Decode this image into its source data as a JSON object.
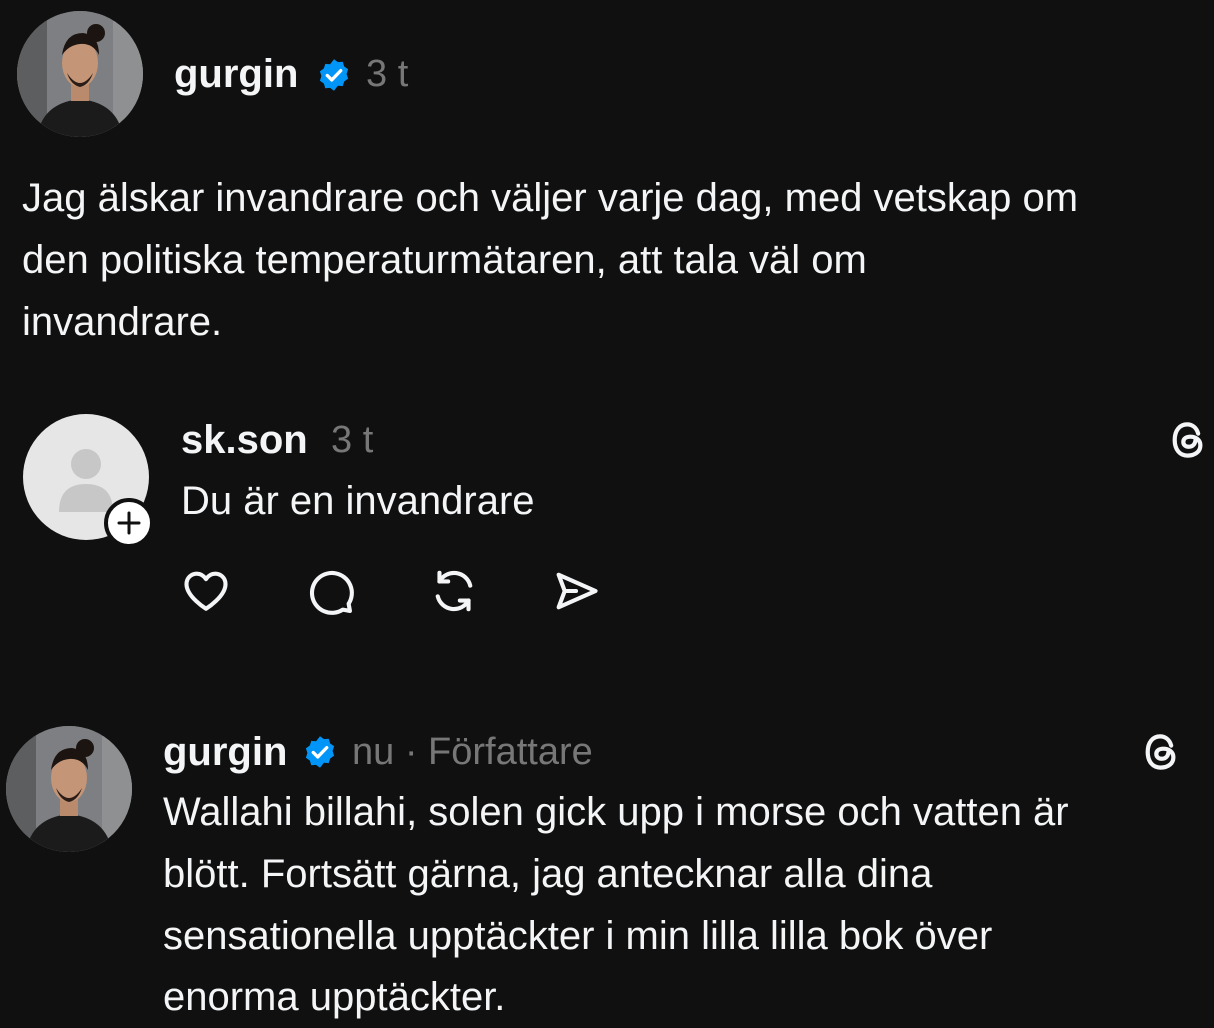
{
  "post": {
    "username": "gurgin",
    "time": "3 t",
    "text_lines": [
      "Jag älskar invandrare och väljer varje dag, med vetskap om",
      "den politiska temperaturmätaren, att tala väl om",
      "invandrare."
    ]
  },
  "reply": {
    "username": "sk.son",
    "time": "3 t",
    "text": "Du är en invandrare",
    "actions": [
      "heart-icon",
      "comment-icon",
      "repost-icon",
      "share-icon"
    ],
    "badge_icon": "threads-icon"
  },
  "author_reply": {
    "username": "gurgin",
    "meta": "nu · Författare",
    "badge_icon": "threads-icon",
    "text_lines": [
      "Wallahi billahi, solen gick upp i morse och vatten är",
      "blött. Fortsätt gärna, jag antecknar alla dina",
      "sensationella upptäckter i min lilla lilla bok över",
      "enorma upptäckter."
    ]
  },
  "colors": {
    "background": "#101010",
    "text": "#f3f5f7",
    "muted": "#777777",
    "verified": "#0095f6"
  }
}
